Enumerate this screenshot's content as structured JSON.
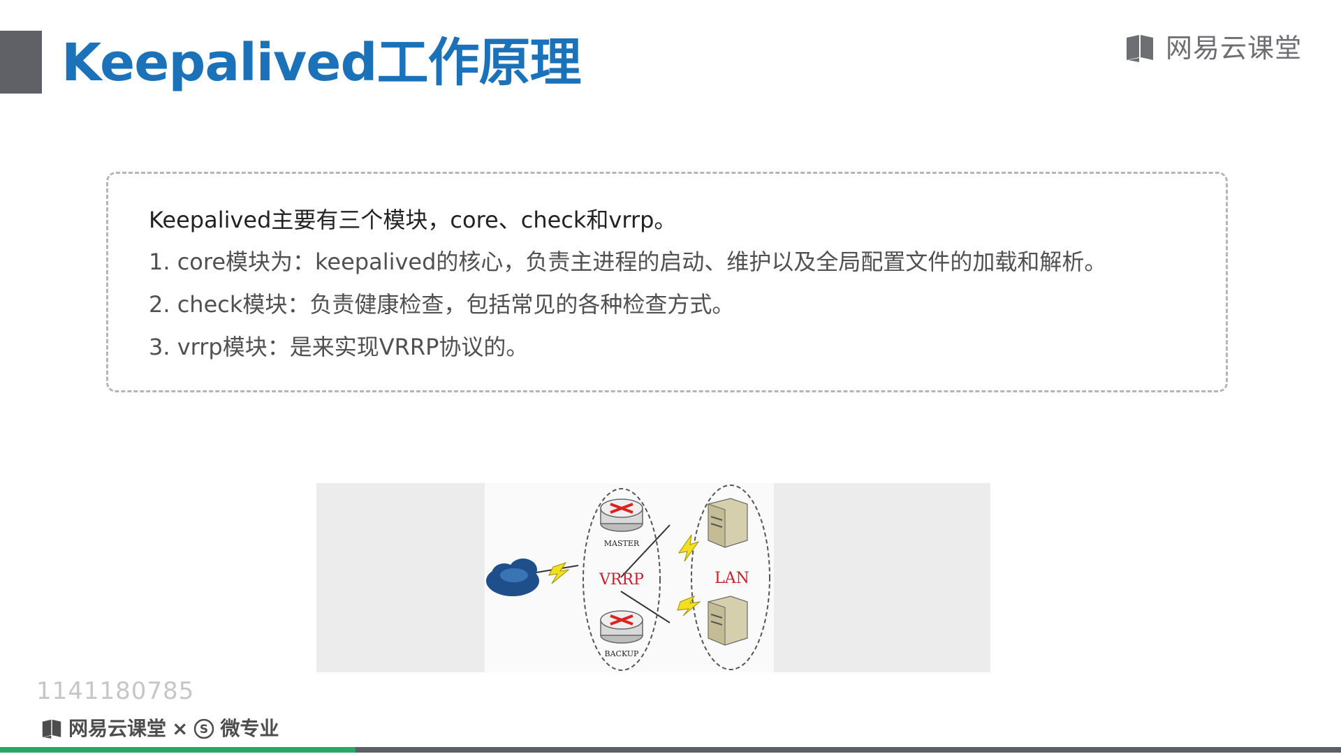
{
  "colors": {
    "title": "#1b72b8",
    "accent_bar": "#5f6166",
    "progress_fill": "#2aa765",
    "vrrp_text": "#c8202b",
    "cloud": "#1e4f8a"
  },
  "header": {
    "title": "Keepalived工作原理",
    "brand": "网易云课堂",
    "brand_icon": "book-icon"
  },
  "content": {
    "intro": "Keepalived主要有三个模块，core、check和vrrp。",
    "items": [
      "1. core模块为：keepalived的核心，负责主进程的启动、维护以及全局配置文件的加载和解析。",
      "2. check模块：负责健康检查，包括常见的各种检查方式。",
      "3. vrrp模块：是来实现VRRP协议的。"
    ]
  },
  "diagram": {
    "router_master_label": "MASTER",
    "router_backup_label": "BACKUP",
    "vrrp_label": "VRRP",
    "lan_label": "LAN",
    "cloud_icon": "cloud-icon",
    "router_icon": "router-icon",
    "server_icon": "server-icon",
    "link_icon": "lightning-icon"
  },
  "footer": {
    "user_id": "1141180785",
    "brand_left": "网易云课堂",
    "separator": "×",
    "brand_right": "微专业",
    "brand_right_icon": "s-circle-icon"
  },
  "progress": {
    "fraction": 0.265
  }
}
